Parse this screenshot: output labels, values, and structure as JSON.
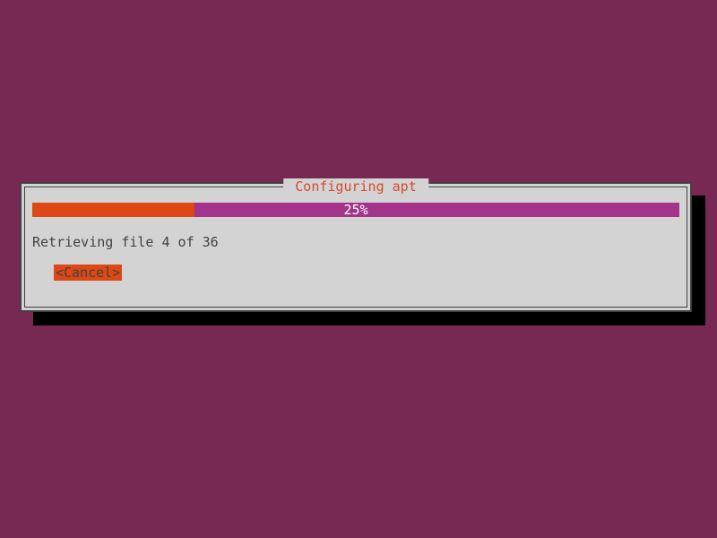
{
  "dialog": {
    "title": " Configuring apt ",
    "progress_percent": 25,
    "progress_label": "25%",
    "status": "Retrieving file 4 of 36",
    "cancel_label": "<Cancel>"
  }
}
